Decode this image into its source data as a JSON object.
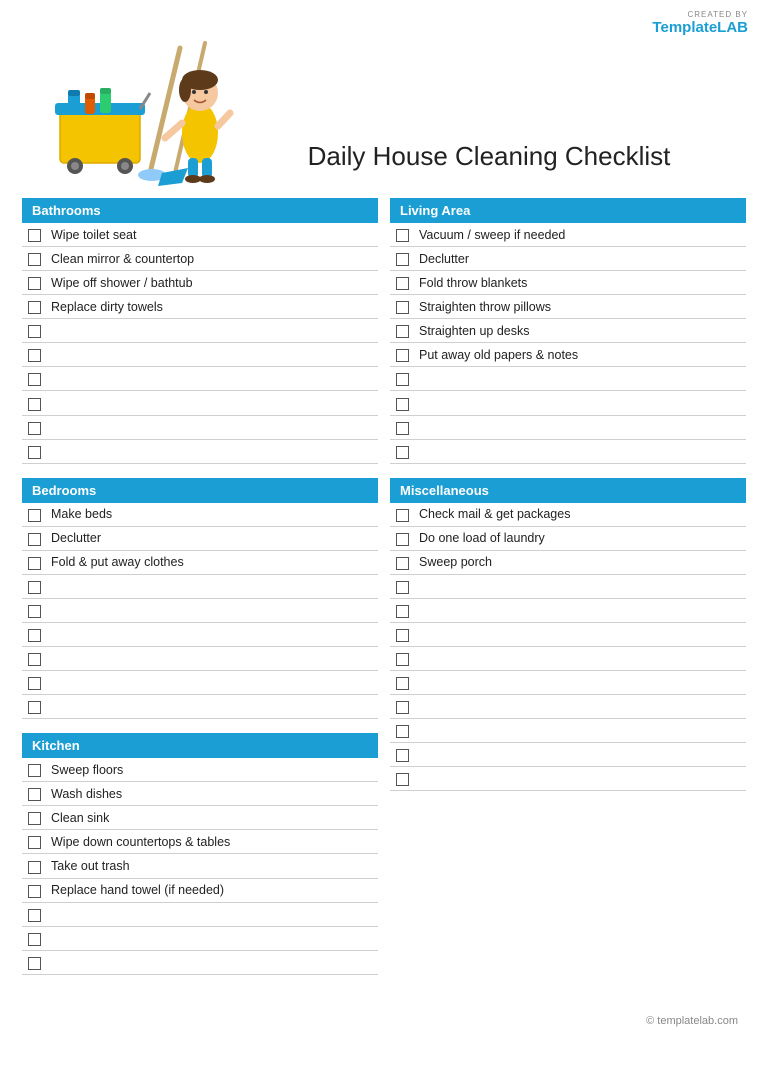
{
  "logo": {
    "created_by": "CREATED BY",
    "brand_template": "Template",
    "brand_lab": "LAB"
  },
  "title": "Daily House Cleaning Checklist",
  "sections": {
    "bathrooms": {
      "label": "Bathrooms",
      "items": [
        "Wipe toilet seat",
        "Clean mirror & countertop",
        "Wipe off shower / bathtub",
        "Replace dirty towels",
        "",
        "",
        "",
        "",
        "",
        ""
      ]
    },
    "living_area": {
      "label": "Living Area",
      "items": [
        "Vacuum / sweep if needed",
        "Declutter",
        "Fold throw blankets",
        "Straighten throw pillows",
        "Straighten up desks",
        "Put away old papers & notes",
        "",
        "",
        "",
        ""
      ]
    },
    "bedrooms": {
      "label": "Bedrooms",
      "items": [
        "Make beds",
        "Declutter",
        "Fold & put away clothes",
        "",
        "",
        "",
        "",
        "",
        ""
      ]
    },
    "miscellaneous": {
      "label": "Miscellaneous",
      "items": [
        "Check mail & get packages",
        "Do one load of laundry",
        "Sweep porch",
        "",
        "",
        "",
        "",
        "",
        "",
        "",
        "",
        ""
      ]
    },
    "kitchen": {
      "label": "Kitchen",
      "items": [
        "Sweep floors",
        "Wash dishes",
        "Clean sink",
        "Wipe down countertops & tables",
        "Take out trash",
        "Replace hand towel (if needed)",
        "",
        "",
        ""
      ]
    }
  },
  "footer": "© templatelab.com"
}
